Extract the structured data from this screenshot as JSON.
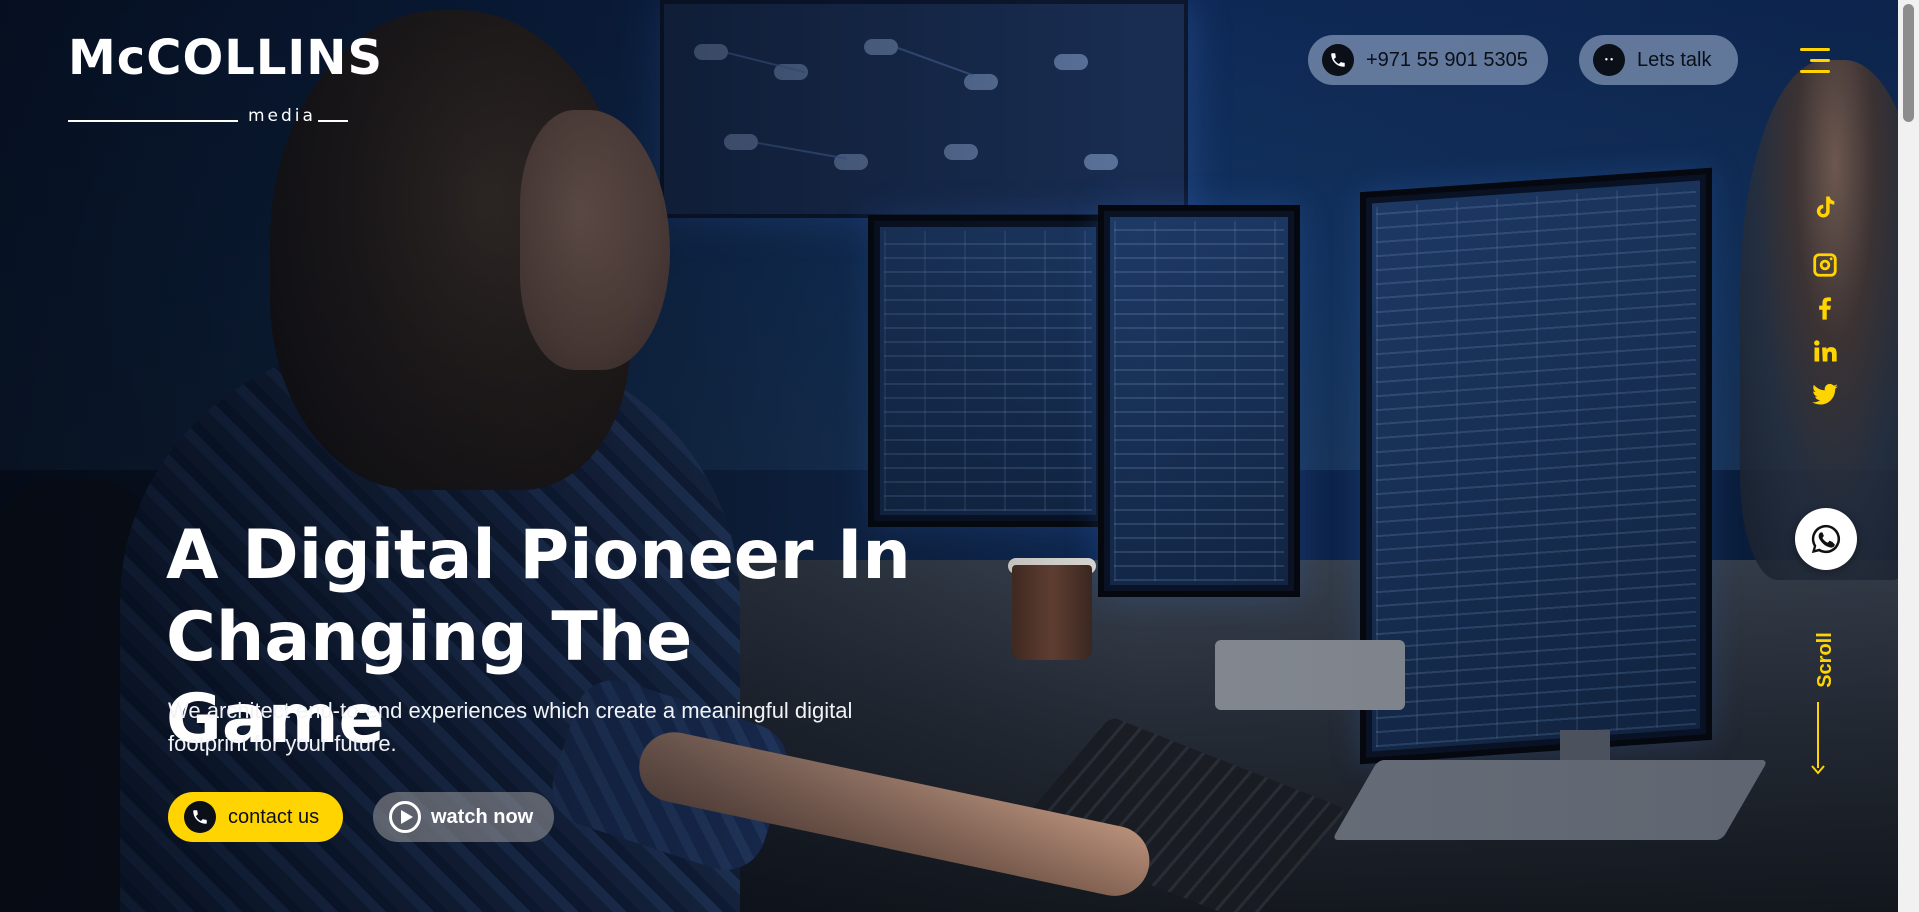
{
  "brand": {
    "name": "McCOLLINS",
    "sub": "media"
  },
  "header": {
    "phone_label": "+971 55 901 5305",
    "talk_label": "Lets talk"
  },
  "socials": [
    {
      "name": "tiktok-icon"
    },
    {
      "name": "instagram-icon"
    },
    {
      "name": "facebook-icon"
    },
    {
      "name": "linkedin-icon"
    },
    {
      "name": "twitter-icon"
    }
  ],
  "hero": {
    "headline_line1": "A Digital Pioneer In",
    "headline_line2": "Changing The Game",
    "subtitle": "We architect end-to-end experiences which create a meaningful digital footprint for your future.",
    "contact_label": "contact us",
    "watch_label": "watch now"
  },
  "scroll_label": "Scroll",
  "colors": {
    "accent": "#ffd400",
    "pill": "#96aac8",
    "watch": "#8c8c91"
  }
}
